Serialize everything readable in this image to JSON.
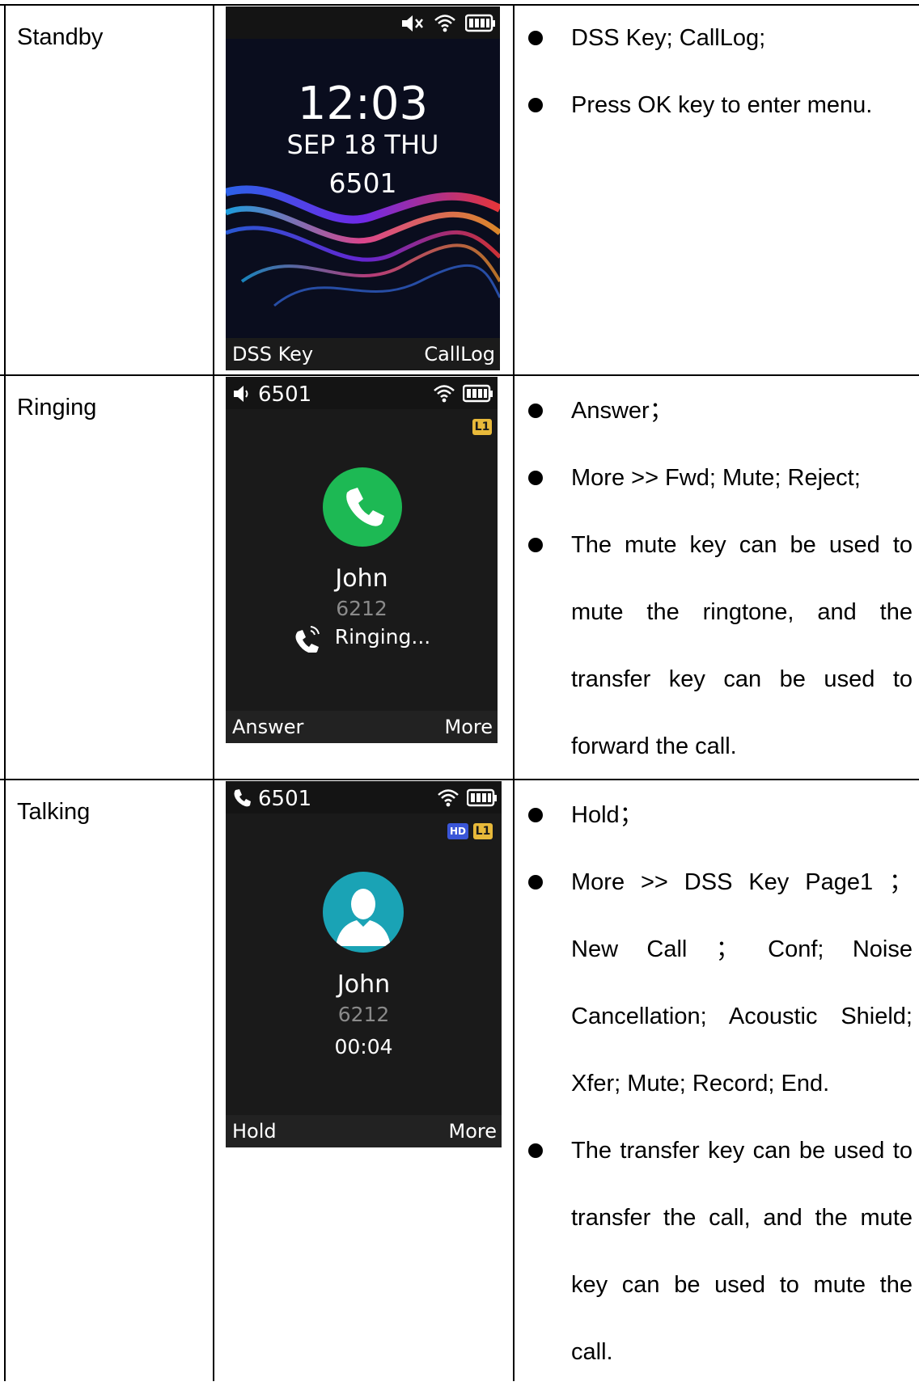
{
  "rows": [
    {
      "label": "Standby",
      "screen": {
        "time": "12:03",
        "date": "SEP 18 THU",
        "extension": "6501",
        "soft_left": "DSS Key",
        "soft_right": "CallLog",
        "status_icons": [
          "mute-icon",
          "wifi-icon",
          "battery-icon"
        ]
      },
      "bullets": [
        "DSS Key; CallLog;",
        "Press OK key to enter menu."
      ]
    },
    {
      "label": "Ringing",
      "screen": {
        "line": "6501",
        "badge_line": "L1",
        "contact_name": "John",
        "contact_number": "6212",
        "status": "Ringing...",
        "soft_left": "Answer",
        "soft_right": "More",
        "status_icons": [
          "speaker-icon",
          "wifi-icon",
          "battery-icon"
        ],
        "accent_color": "#1db954"
      },
      "bullets": [
        "Answer；",
        "More >> Fwd; Mute; Reject;",
        "The mute key can be used to mute the ringtone, and the transfer key can be used to forward the call."
      ]
    },
    {
      "label": "Talking",
      "screen": {
        "line": "6501",
        "badge_hd": "HD",
        "badge_line": "L1",
        "contact_name": "John",
        "contact_number": "6212",
        "duration": "00:04",
        "soft_left": "Hold",
        "soft_right": "More",
        "status_icons": [
          "handset-icon",
          "wifi-icon",
          "battery-icon"
        ],
        "accent_color": "#1aa3b5"
      },
      "bullets": [
        "Hold；",
        "More >> DSS Key Page1 ； New Call ； Conf; Noise Cancellation; Acoustic Shield; Xfer; Mute; Record; End.",
        "The transfer key can be used to transfer the call, and the mute key can be used to mute the call."
      ]
    }
  ]
}
